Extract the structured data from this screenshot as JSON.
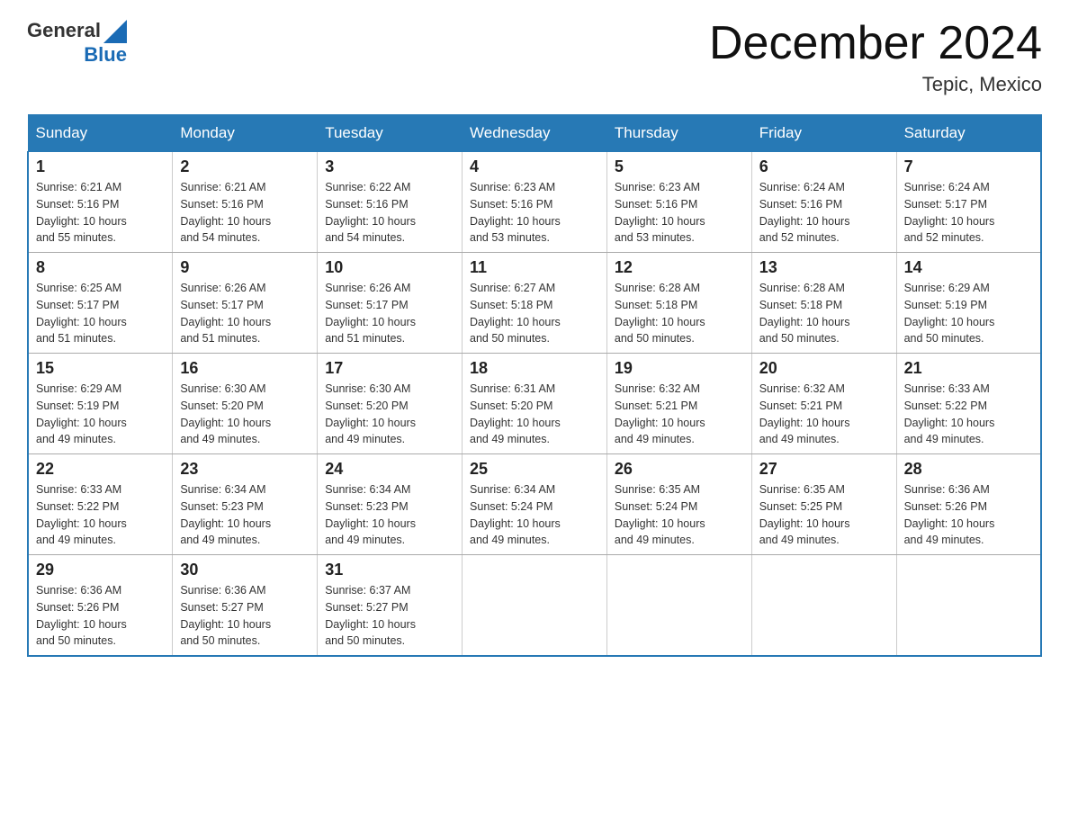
{
  "header": {
    "logo_general": "General",
    "logo_blue": "Blue",
    "title": "December 2024",
    "subtitle": "Tepic, Mexico"
  },
  "days_of_week": [
    "Sunday",
    "Monday",
    "Tuesday",
    "Wednesday",
    "Thursday",
    "Friday",
    "Saturday"
  ],
  "weeks": [
    [
      {
        "day": "1",
        "sunrise": "6:21 AM",
        "sunset": "5:16 PM",
        "daylight": "10 hours and 55 minutes."
      },
      {
        "day": "2",
        "sunrise": "6:21 AM",
        "sunset": "5:16 PM",
        "daylight": "10 hours and 54 minutes."
      },
      {
        "day": "3",
        "sunrise": "6:22 AM",
        "sunset": "5:16 PM",
        "daylight": "10 hours and 54 minutes."
      },
      {
        "day": "4",
        "sunrise": "6:23 AM",
        "sunset": "5:16 PM",
        "daylight": "10 hours and 53 minutes."
      },
      {
        "day": "5",
        "sunrise": "6:23 AM",
        "sunset": "5:16 PM",
        "daylight": "10 hours and 53 minutes."
      },
      {
        "day": "6",
        "sunrise": "6:24 AM",
        "sunset": "5:16 PM",
        "daylight": "10 hours and 52 minutes."
      },
      {
        "day": "7",
        "sunrise": "6:24 AM",
        "sunset": "5:17 PM",
        "daylight": "10 hours and 52 minutes."
      }
    ],
    [
      {
        "day": "8",
        "sunrise": "6:25 AM",
        "sunset": "5:17 PM",
        "daylight": "10 hours and 51 minutes."
      },
      {
        "day": "9",
        "sunrise": "6:26 AM",
        "sunset": "5:17 PM",
        "daylight": "10 hours and 51 minutes."
      },
      {
        "day": "10",
        "sunrise": "6:26 AM",
        "sunset": "5:17 PM",
        "daylight": "10 hours and 51 minutes."
      },
      {
        "day": "11",
        "sunrise": "6:27 AM",
        "sunset": "5:18 PM",
        "daylight": "10 hours and 50 minutes."
      },
      {
        "day": "12",
        "sunrise": "6:28 AM",
        "sunset": "5:18 PM",
        "daylight": "10 hours and 50 minutes."
      },
      {
        "day": "13",
        "sunrise": "6:28 AM",
        "sunset": "5:18 PM",
        "daylight": "10 hours and 50 minutes."
      },
      {
        "day": "14",
        "sunrise": "6:29 AM",
        "sunset": "5:19 PM",
        "daylight": "10 hours and 50 minutes."
      }
    ],
    [
      {
        "day": "15",
        "sunrise": "6:29 AM",
        "sunset": "5:19 PM",
        "daylight": "10 hours and 49 minutes."
      },
      {
        "day": "16",
        "sunrise": "6:30 AM",
        "sunset": "5:20 PM",
        "daylight": "10 hours and 49 minutes."
      },
      {
        "day": "17",
        "sunrise": "6:30 AM",
        "sunset": "5:20 PM",
        "daylight": "10 hours and 49 minutes."
      },
      {
        "day": "18",
        "sunrise": "6:31 AM",
        "sunset": "5:20 PM",
        "daylight": "10 hours and 49 minutes."
      },
      {
        "day": "19",
        "sunrise": "6:32 AM",
        "sunset": "5:21 PM",
        "daylight": "10 hours and 49 minutes."
      },
      {
        "day": "20",
        "sunrise": "6:32 AM",
        "sunset": "5:21 PM",
        "daylight": "10 hours and 49 minutes."
      },
      {
        "day": "21",
        "sunrise": "6:33 AM",
        "sunset": "5:22 PM",
        "daylight": "10 hours and 49 minutes."
      }
    ],
    [
      {
        "day": "22",
        "sunrise": "6:33 AM",
        "sunset": "5:22 PM",
        "daylight": "10 hours and 49 minutes."
      },
      {
        "day": "23",
        "sunrise": "6:34 AM",
        "sunset": "5:23 PM",
        "daylight": "10 hours and 49 minutes."
      },
      {
        "day": "24",
        "sunrise": "6:34 AM",
        "sunset": "5:23 PM",
        "daylight": "10 hours and 49 minutes."
      },
      {
        "day": "25",
        "sunrise": "6:34 AM",
        "sunset": "5:24 PM",
        "daylight": "10 hours and 49 minutes."
      },
      {
        "day": "26",
        "sunrise": "6:35 AM",
        "sunset": "5:24 PM",
        "daylight": "10 hours and 49 minutes."
      },
      {
        "day": "27",
        "sunrise": "6:35 AM",
        "sunset": "5:25 PM",
        "daylight": "10 hours and 49 minutes."
      },
      {
        "day": "28",
        "sunrise": "6:36 AM",
        "sunset": "5:26 PM",
        "daylight": "10 hours and 49 minutes."
      }
    ],
    [
      {
        "day": "29",
        "sunrise": "6:36 AM",
        "sunset": "5:26 PM",
        "daylight": "10 hours and 50 minutes."
      },
      {
        "day": "30",
        "sunrise": "6:36 AM",
        "sunset": "5:27 PM",
        "daylight": "10 hours and 50 minutes."
      },
      {
        "day": "31",
        "sunrise": "6:37 AM",
        "sunset": "5:27 PM",
        "daylight": "10 hours and 50 minutes."
      },
      null,
      null,
      null,
      null
    ]
  ],
  "labels": {
    "sunrise": "Sunrise:",
    "sunset": "Sunset:",
    "daylight": "Daylight:"
  }
}
